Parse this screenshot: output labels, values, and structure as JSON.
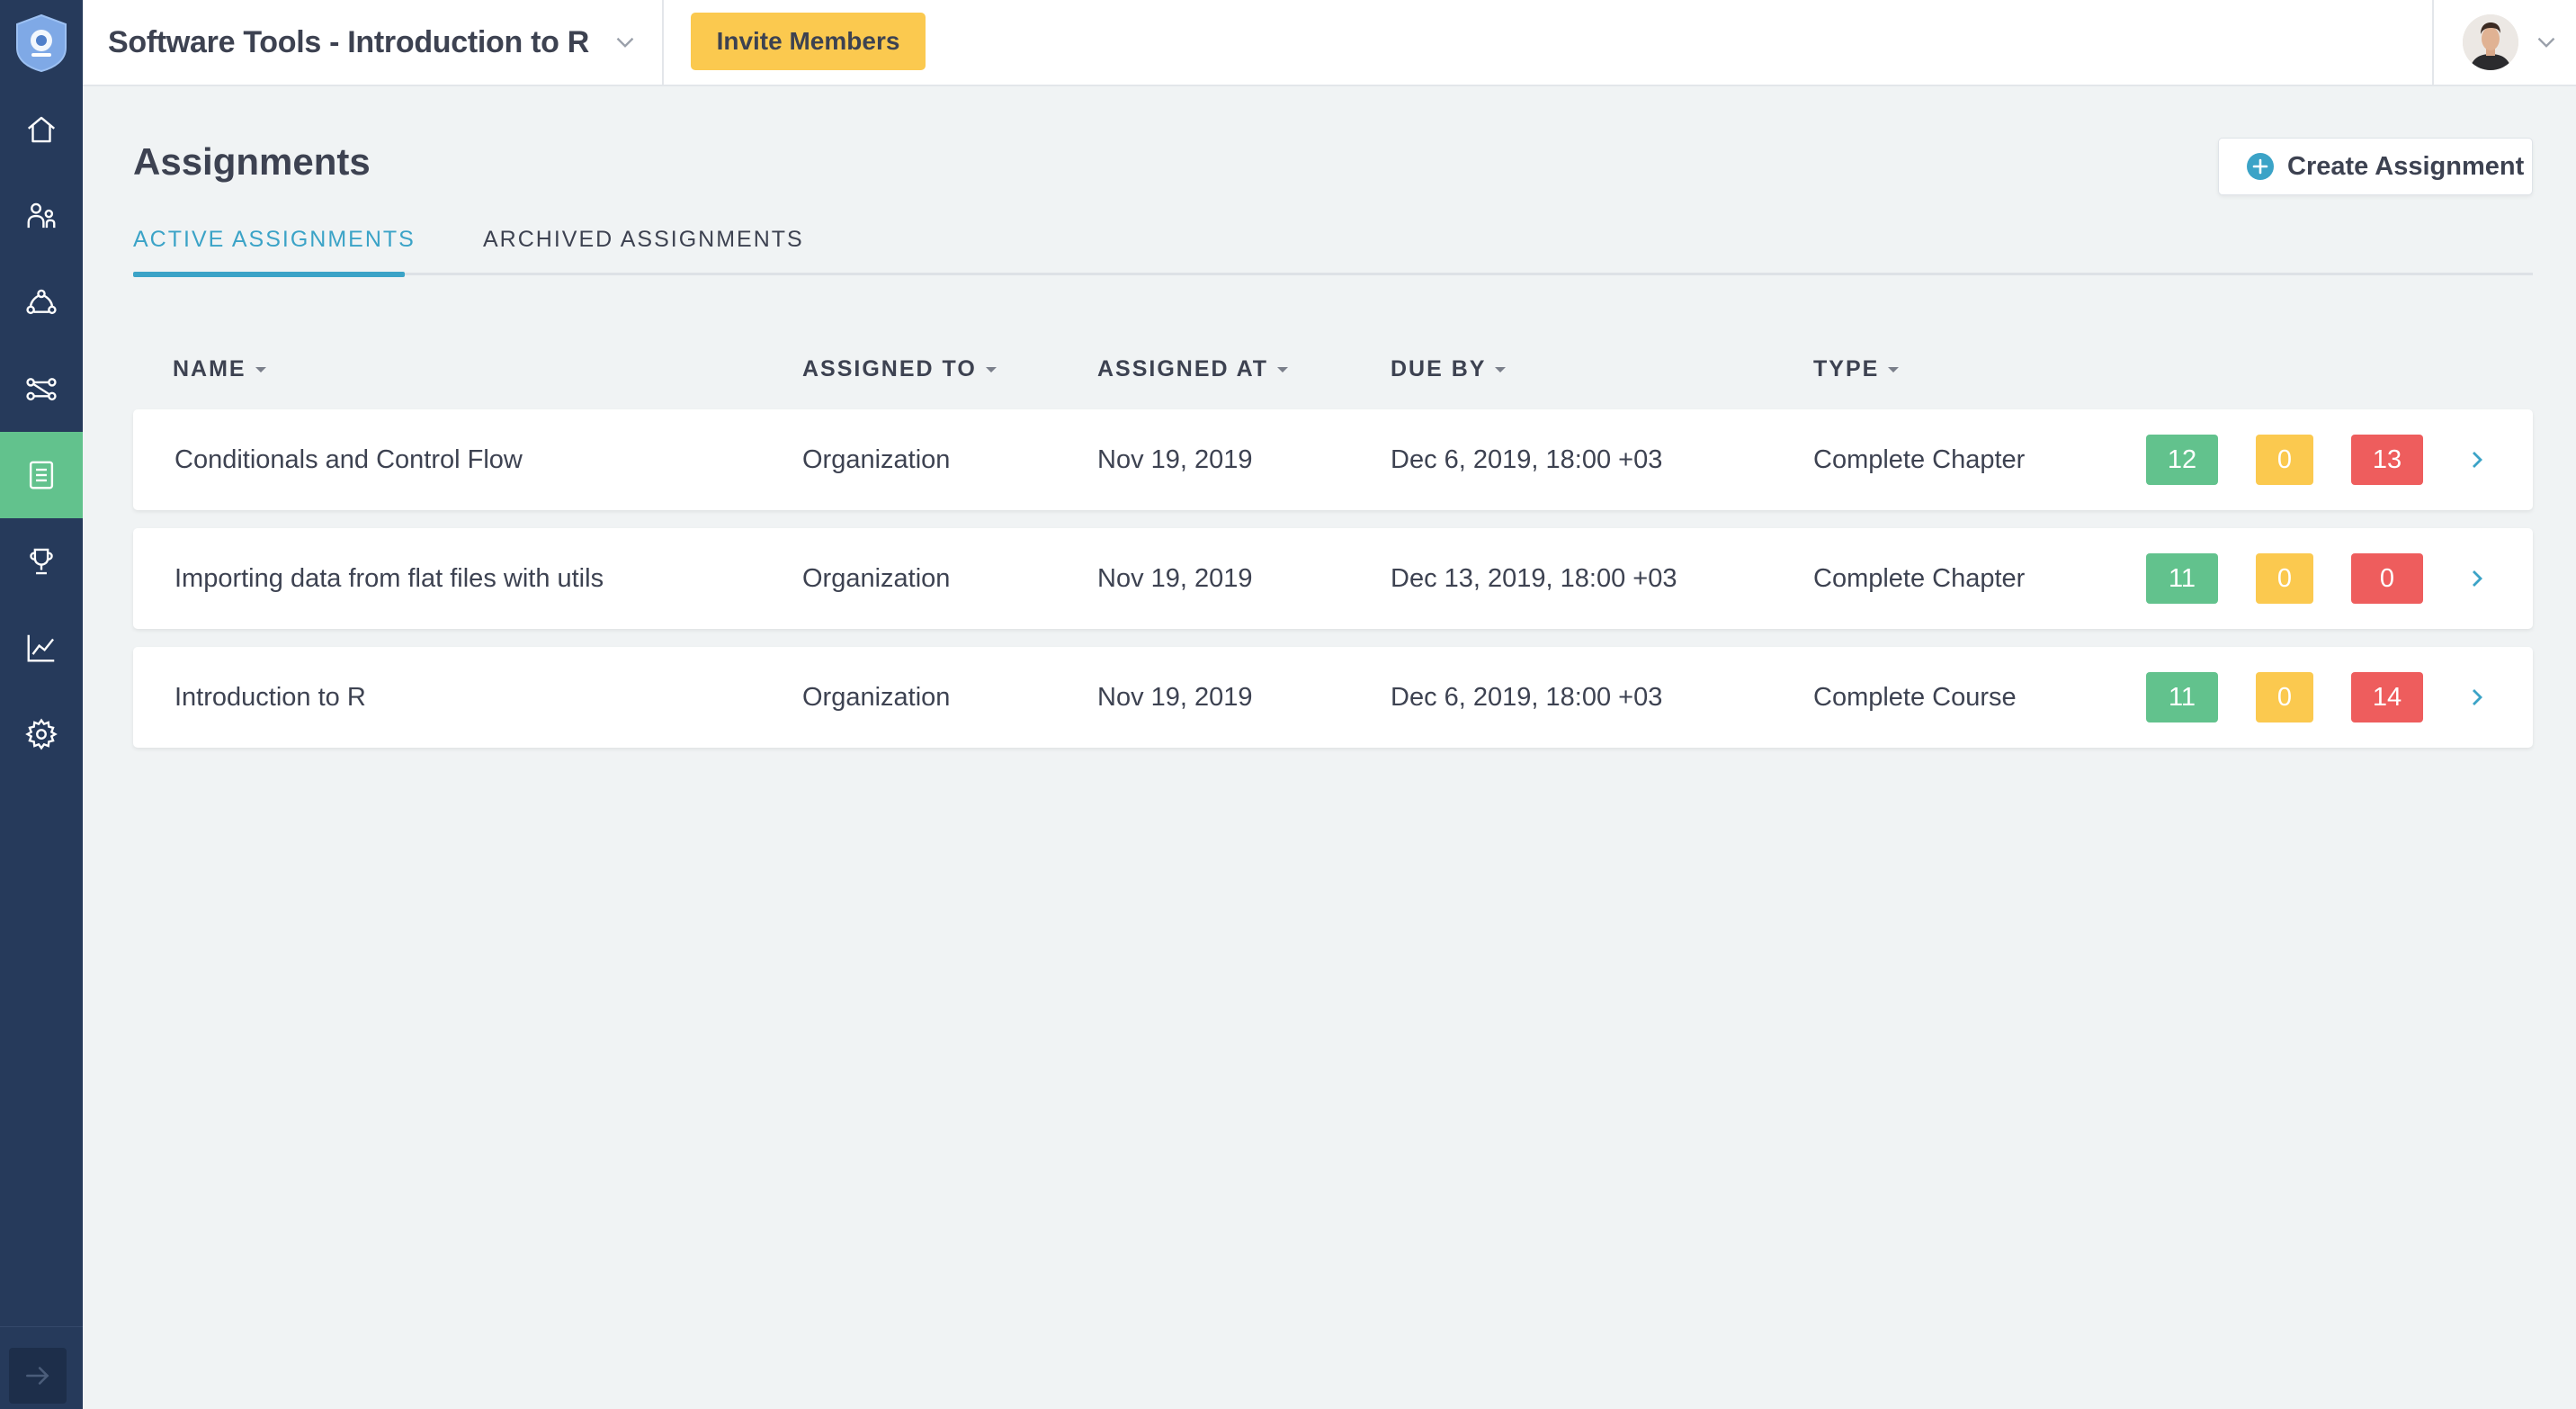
{
  "app": {
    "org_title": "Software Tools - Introduction to R",
    "invite_label": "Invite Members"
  },
  "sidebar": {
    "items": [
      {
        "icon": "home-icon"
      },
      {
        "icon": "people-icon"
      },
      {
        "icon": "groups-icon"
      },
      {
        "icon": "tracks-icon"
      },
      {
        "icon": "assignments-icon",
        "active": true
      },
      {
        "icon": "trophy-icon"
      },
      {
        "icon": "reports-chart-icon"
      },
      {
        "icon": "settings-gear-icon"
      }
    ],
    "collapse_icon": "arrow-right-icon"
  },
  "main": {
    "title": "Assignments",
    "create_label": "Create Assignment",
    "tabs": [
      {
        "label": "ACTIVE ASSIGNMENTS",
        "active": true
      },
      {
        "label": "ARCHIVED ASSIGNMENTS",
        "active": false
      }
    ],
    "columns": [
      "NAME",
      "ASSIGNED TO",
      "ASSIGNED AT",
      "DUE BY",
      "TYPE"
    ],
    "rows": [
      {
        "name": "Conditionals and Control Flow",
        "assigned_to": "Organization",
        "assigned_at": "Nov 19, 2019",
        "due_by": "Dec 6, 2019, 18:00 +03",
        "type": "Complete Chapter",
        "completed": "12",
        "in_progress": "0",
        "not_started": "13"
      },
      {
        "name": "Importing data from flat files with utils",
        "assigned_to": "Organization",
        "assigned_at": "Nov 19, 2019",
        "due_by": "Dec 13, 2019, 18:00 +03",
        "type": "Complete Chapter",
        "completed": "11",
        "in_progress": "0",
        "not_started": "0"
      },
      {
        "name": "Introduction to R",
        "assigned_to": "Organization",
        "assigned_at": "Nov 19, 2019",
        "due_by": "Dec 6, 2019, 18:00 +03",
        "type": "Complete Course",
        "completed": "11",
        "in_progress": "0",
        "not_started": "14"
      }
    ]
  },
  "colors": {
    "sidebar_bg": "#263a5b",
    "active_nav": "#62c28d",
    "accent_blue": "#3ba3c7",
    "invite_yellow": "#fbc94f",
    "badge_green": "#62c28d",
    "badge_yellow": "#fbc94f",
    "badge_red": "#ee5d5d"
  }
}
